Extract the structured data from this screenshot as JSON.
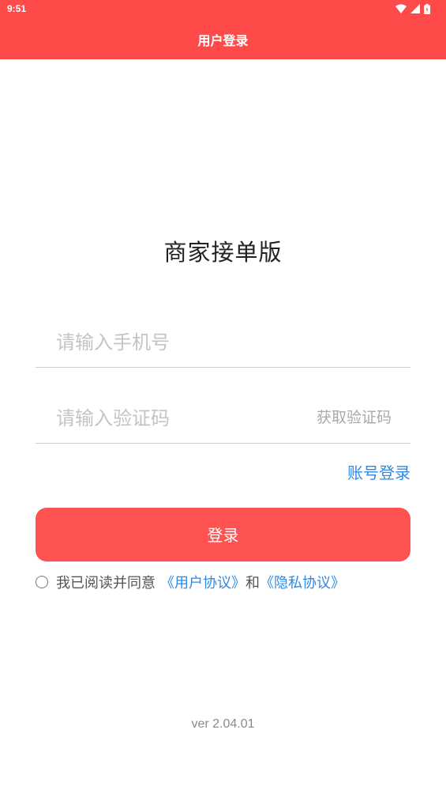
{
  "status_bar": {
    "time": "9:51",
    "icons": [
      "wifi-icon",
      "signal-icon",
      "battery-icon"
    ]
  },
  "header": {
    "title": "用户登录",
    "background_color": "#ff4a4a"
  },
  "app_title": "商家接单版",
  "form": {
    "phone_placeholder": "请输入手机号",
    "phone_value": "",
    "code_placeholder": "请输入验证码",
    "code_value": "",
    "get_code_label": "获取验证码",
    "account_login_label": "账号登录",
    "login_label": "登录",
    "login_color": "#ff5252"
  },
  "agreement": {
    "checked": false,
    "prefix": "我已阅读并同意",
    "user_agreement": "《用户协议》",
    "joiner": "和",
    "privacy_agreement": "《隐私协议》",
    "link_color": "#2c8ae6"
  },
  "version": "ver 2.04.01"
}
